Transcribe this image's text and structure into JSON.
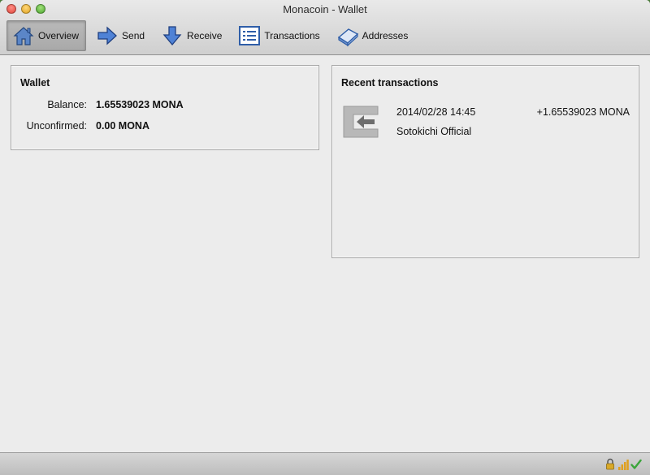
{
  "window": {
    "title": "Monacoin - Wallet"
  },
  "toolbar": {
    "items": [
      {
        "label": "Overview",
        "icon": "home-icon",
        "active": true
      },
      {
        "label": "Send",
        "icon": "arrow-right-icon",
        "active": false
      },
      {
        "label": "Receive",
        "icon": "arrow-down-icon",
        "active": false
      },
      {
        "label": "Transactions",
        "icon": "list-icon",
        "active": false
      },
      {
        "label": "Addresses",
        "icon": "address-book-icon",
        "active": false
      }
    ]
  },
  "wallet": {
    "title": "Wallet",
    "balance_label": "Balance:",
    "balance_value": "1.65539023 MONA",
    "unconfirmed_label": "Unconfirmed:",
    "unconfirmed_value": "0.00 MONA"
  },
  "recent": {
    "title": "Recent transactions",
    "transactions": [
      {
        "date": "2014/02/28 14:45",
        "amount": "+1.65539023 MONA",
        "label": "Sotokichi Official",
        "icon": "incoming-transaction-icon"
      }
    ]
  },
  "statusbar": {
    "icons": [
      "lock-icon",
      "signal-bars-icon",
      "synced-check-icon"
    ],
    "accent_check": "#3aa53a",
    "signal_color": "#e0a020"
  }
}
